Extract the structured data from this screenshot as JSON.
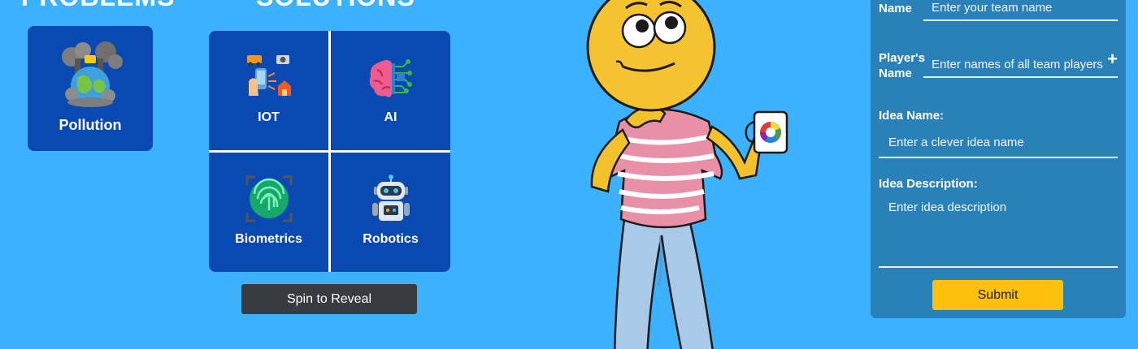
{
  "problems": {
    "heading": "PROBLEMS",
    "cards": [
      {
        "label": "Pollution",
        "icon": "polluted-earth-icon"
      }
    ]
  },
  "solutions": {
    "heading": "SOLUTIONS",
    "tiles": [
      {
        "label": "IOT",
        "icon": "iot-devices-icon"
      },
      {
        "label": "AI",
        "icon": "ai-brain-icon"
      },
      {
        "label": "Biometrics",
        "icon": "fingerprint-icon"
      },
      {
        "label": "Robotics",
        "icon": "robot-icon"
      }
    ],
    "spin_button": "Spin to Reveal"
  },
  "form": {
    "team_name": {
      "label": "Team Name",
      "placeholder": "Enter your team name"
    },
    "players_name": {
      "label": "Player's Name",
      "placeholder": "Enter names of all team players"
    },
    "idea_name": {
      "label": "Idea Name:",
      "placeholder": "Enter a clever idea name"
    },
    "idea_description": {
      "label": "Idea Description:",
      "placeholder": "Enter idea description"
    },
    "submit_button": "Submit"
  },
  "colors": {
    "page_background": "#3cb1fd",
    "card_blue": "#0a49b2",
    "form_panel": "#2a81b9",
    "submit_yellow": "#fdc10c",
    "spin_button_dark": "#383b3f"
  }
}
